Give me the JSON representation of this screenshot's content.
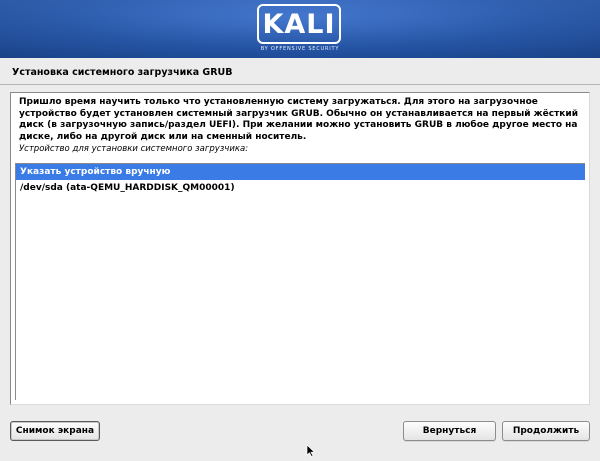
{
  "banner": {
    "logo_text": "KALI",
    "logo_subtitle": "BY OFFENSIVE SECURITY",
    "bg_color": "#2557ad"
  },
  "page": {
    "title": "Установка системного загрузчика GRUB"
  },
  "main": {
    "description_lines": [
      "Пришло время научить только что установленную систему загружаться. Для этого на загрузочное",
      "устройство будет установлен системный загрузчик GRUB. Обычно он устанавливается на первый жёсткий",
      "диск (в загрузочную запись/раздел UEFI). При желании можно установить GRUB в любое другое место на",
      "диске, либо на другой диск или на сменный носитель."
    ],
    "list_label": "Устройство для установки системного загрузчика:",
    "options": [
      {
        "label": "Указать устройство вручную",
        "selected": true
      },
      {
        "label": "/dev/sda  (ata-QEMU_HARDDISK_QM00001)",
        "selected": false
      }
    ],
    "selection_color": "#3b7be6"
  },
  "buttons": {
    "screenshot": "Снимок экрана",
    "back": "Вернуться",
    "continue": "Продолжить"
  },
  "cursor_icon": "mouse-pointer-icon"
}
